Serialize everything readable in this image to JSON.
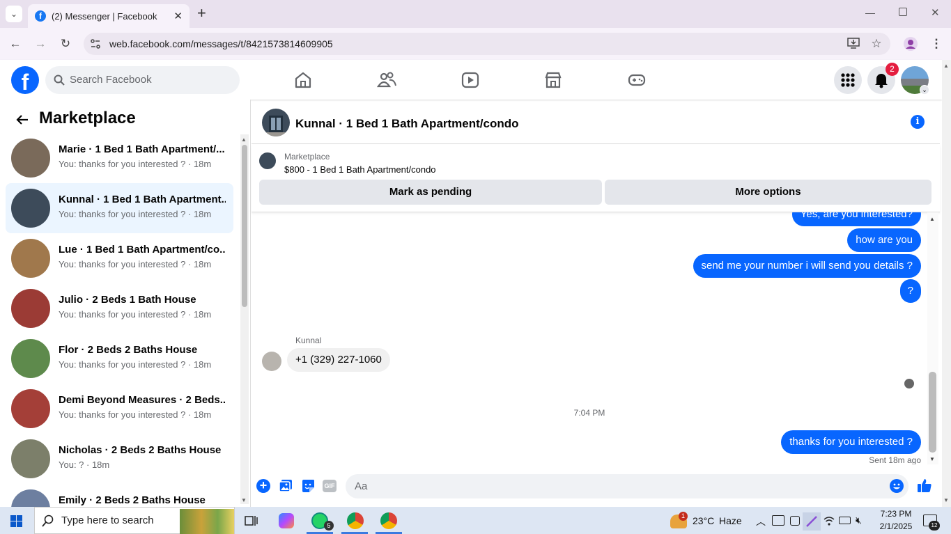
{
  "browser": {
    "tab_title": "(2) Messenger | Facebook",
    "url": "web.facebook.com/messages/t/8421573814609905",
    "new_tab": "+",
    "close": "✕"
  },
  "fb": {
    "search_placeholder": "Search Facebook",
    "notifications_count": "2"
  },
  "sidebar": {
    "title": "Marketplace",
    "conversations": [
      {
        "name": "Marie · 1 Bed 1 Bath Apartment/...",
        "snippet": "You: thanks for you interested ? · 18m",
        "color": "#7a6a5a"
      },
      {
        "name": "Kunnal · 1 Bed 1 Bath Apartment...",
        "snippet": "You: thanks for you interested ? · 18m",
        "color": "#3d4b5a",
        "active": true
      },
      {
        "name": "Lue · 1 Bed 1 Bath Apartment/co...",
        "snippet": "You: thanks for you interested ? · 18m",
        "color": "#a0784c"
      },
      {
        "name": "Julio · 2 Beds 1 Bath House",
        "snippet": "You: thanks for you interested ? · 18m",
        "color": "#9b3b35"
      },
      {
        "name": "Flor · 2 Beds 2 Baths House",
        "snippet": "You: thanks for you interested ? · 18m",
        "color": "#5e8a4c"
      },
      {
        "name": "Demi Beyond Measures · 2 Beds...",
        "snippet": "You: thanks for you interested ? · 18m",
        "color": "#a43f38"
      },
      {
        "name": "Nicholas · 2 Beds 2 Baths House",
        "snippet": "You: ? · 18m",
        "color": "#7c7f6a"
      },
      {
        "name": "Emily · 2 Beds 2 Baths House",
        "snippet": "",
        "color": "#6d7fa0"
      }
    ]
  },
  "chat": {
    "header_name": "Kunnal · 1 Bed 1 Bath Apartment/condo",
    "listing_label": "Marketplace",
    "listing_title": "$800 - 1 Bed 1 Bath Apartment/condo",
    "mark_pending": "Mark as pending",
    "more_options": "More options",
    "out_messages": [
      "Yes, are you interested?",
      "how are you",
      "send me your number i will send you details ?",
      "?"
    ],
    "sender_name": "Kunnal",
    "in_message": "+1 (329) 227-1060",
    "timestamp": "7:04 PM",
    "last_message": "thanks for you interested ?",
    "status": "Sent 18m ago",
    "composer_placeholder": "Aa",
    "gif_label": "GIF"
  },
  "taskbar": {
    "search_placeholder": "Type here to search",
    "weather_temp": "23°C",
    "weather_desc": "Haze",
    "weather_badge": "1",
    "time": "7:23 PM",
    "date": "2/1/2025",
    "notif_count": "12",
    "whatsapp_badge": "5"
  },
  "colors": {
    "accent": "#0866ff",
    "badge": "#e41e3f"
  }
}
